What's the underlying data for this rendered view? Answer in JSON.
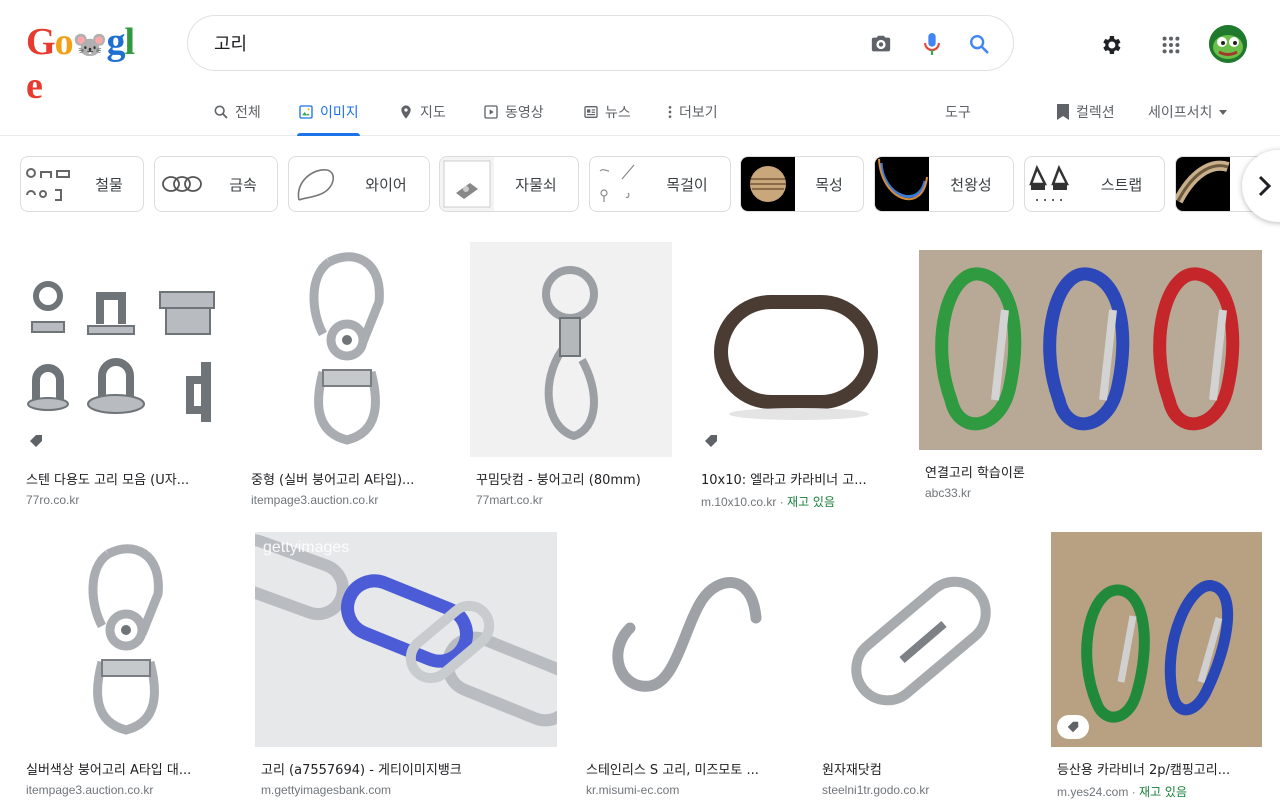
{
  "header": {
    "logo_letters": [
      "G",
      "o",
      "🐭",
      "g",
      "l",
      "e"
    ],
    "search_value": "고리",
    "icons": [
      "camera-icon",
      "mic-icon",
      "search-icon",
      "gear-icon",
      "apps-icon",
      "avatar"
    ]
  },
  "tabs": [
    {
      "label": "전체",
      "icon": "search-icon"
    },
    {
      "label": "이미지",
      "icon": "image-icon",
      "active": true
    },
    {
      "label": "지도",
      "icon": "pin-icon"
    },
    {
      "label": "동영상",
      "icon": "play-icon"
    },
    {
      "label": "뉴스",
      "icon": "news-icon"
    },
    {
      "label": "더보기",
      "icon": "more-icon"
    },
    {
      "label": "도구"
    },
    {
      "label": "컬렉션",
      "icon": "bookmark-icon"
    },
    {
      "label": "세이프서치",
      "icon": "caret-down-icon"
    }
  ],
  "chips": [
    {
      "label": "철물"
    },
    {
      "label": "금속"
    },
    {
      "label": "와이어"
    },
    {
      "label": "자물쇠"
    },
    {
      "label": "목걸이"
    },
    {
      "label": "목성"
    },
    {
      "label": "천왕성"
    },
    {
      "label": "스트랩"
    },
    {
      "label": ""
    }
  ],
  "results": [
    {
      "title": "스텐 다용도 고리 모음 (U자...",
      "source": "77ro.co.kr",
      "stock": ""
    },
    {
      "title": "중형 (실버 붕어고리 A타입)...",
      "source": "itempage3.auction.co.kr",
      "stock": ""
    },
    {
      "title": "꾸밈닷컴 - 붕어고리 (80mm)",
      "source": "77mart.co.kr",
      "stock": ""
    },
    {
      "title": "10x10: 엘라고 카라비너 고...",
      "source": "m.10x10.co.kr · ",
      "stock": "재고 있음"
    },
    {
      "title": "연결고리 학습이론",
      "source": "abc33.kr",
      "stock": ""
    },
    {
      "title": "실버색상 붕어고리 A타입 대...",
      "source": "itempage3.auction.co.kr",
      "stock": ""
    },
    {
      "title": "고리 (a7557694) - 게티이미지뱅크",
      "source": "m.gettyimagesbank.com",
      "stock": ""
    },
    {
      "title": "스테인리스 S 고리, 미즈모토 ...",
      "source": "kr.misumi-ec.com",
      "stock": ""
    },
    {
      "title": "원자재닷컴",
      "source": "steelni1tr.godo.co.kr",
      "stock": ""
    },
    {
      "title": "등산용 카라비너 2p/캠핑고리...",
      "source": "m.yes24.com · ",
      "stock": "재고 있음"
    }
  ],
  "watermark": "gettyimages",
  "colors": {
    "accent": "#1a73e8",
    "stock_green": "#188038"
  }
}
